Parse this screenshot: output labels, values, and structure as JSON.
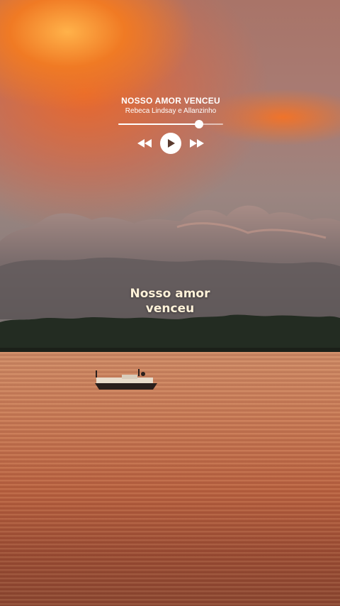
{
  "player": {
    "title": "NOSSO AMOR VENCEU",
    "artist": "Rebeca Lindsay e Allanzinho",
    "progress": 0.77,
    "icons": {
      "previous": "rewind-icon",
      "play": "play-icon",
      "next": "fast-forward-icon"
    }
  },
  "lyric": {
    "line1": "Nosso amor",
    "line2": "venceu"
  },
  "colors": {
    "text": "#ffffff",
    "lyric_text": "#fff2d9",
    "play_icon": "#5a3a2e"
  }
}
